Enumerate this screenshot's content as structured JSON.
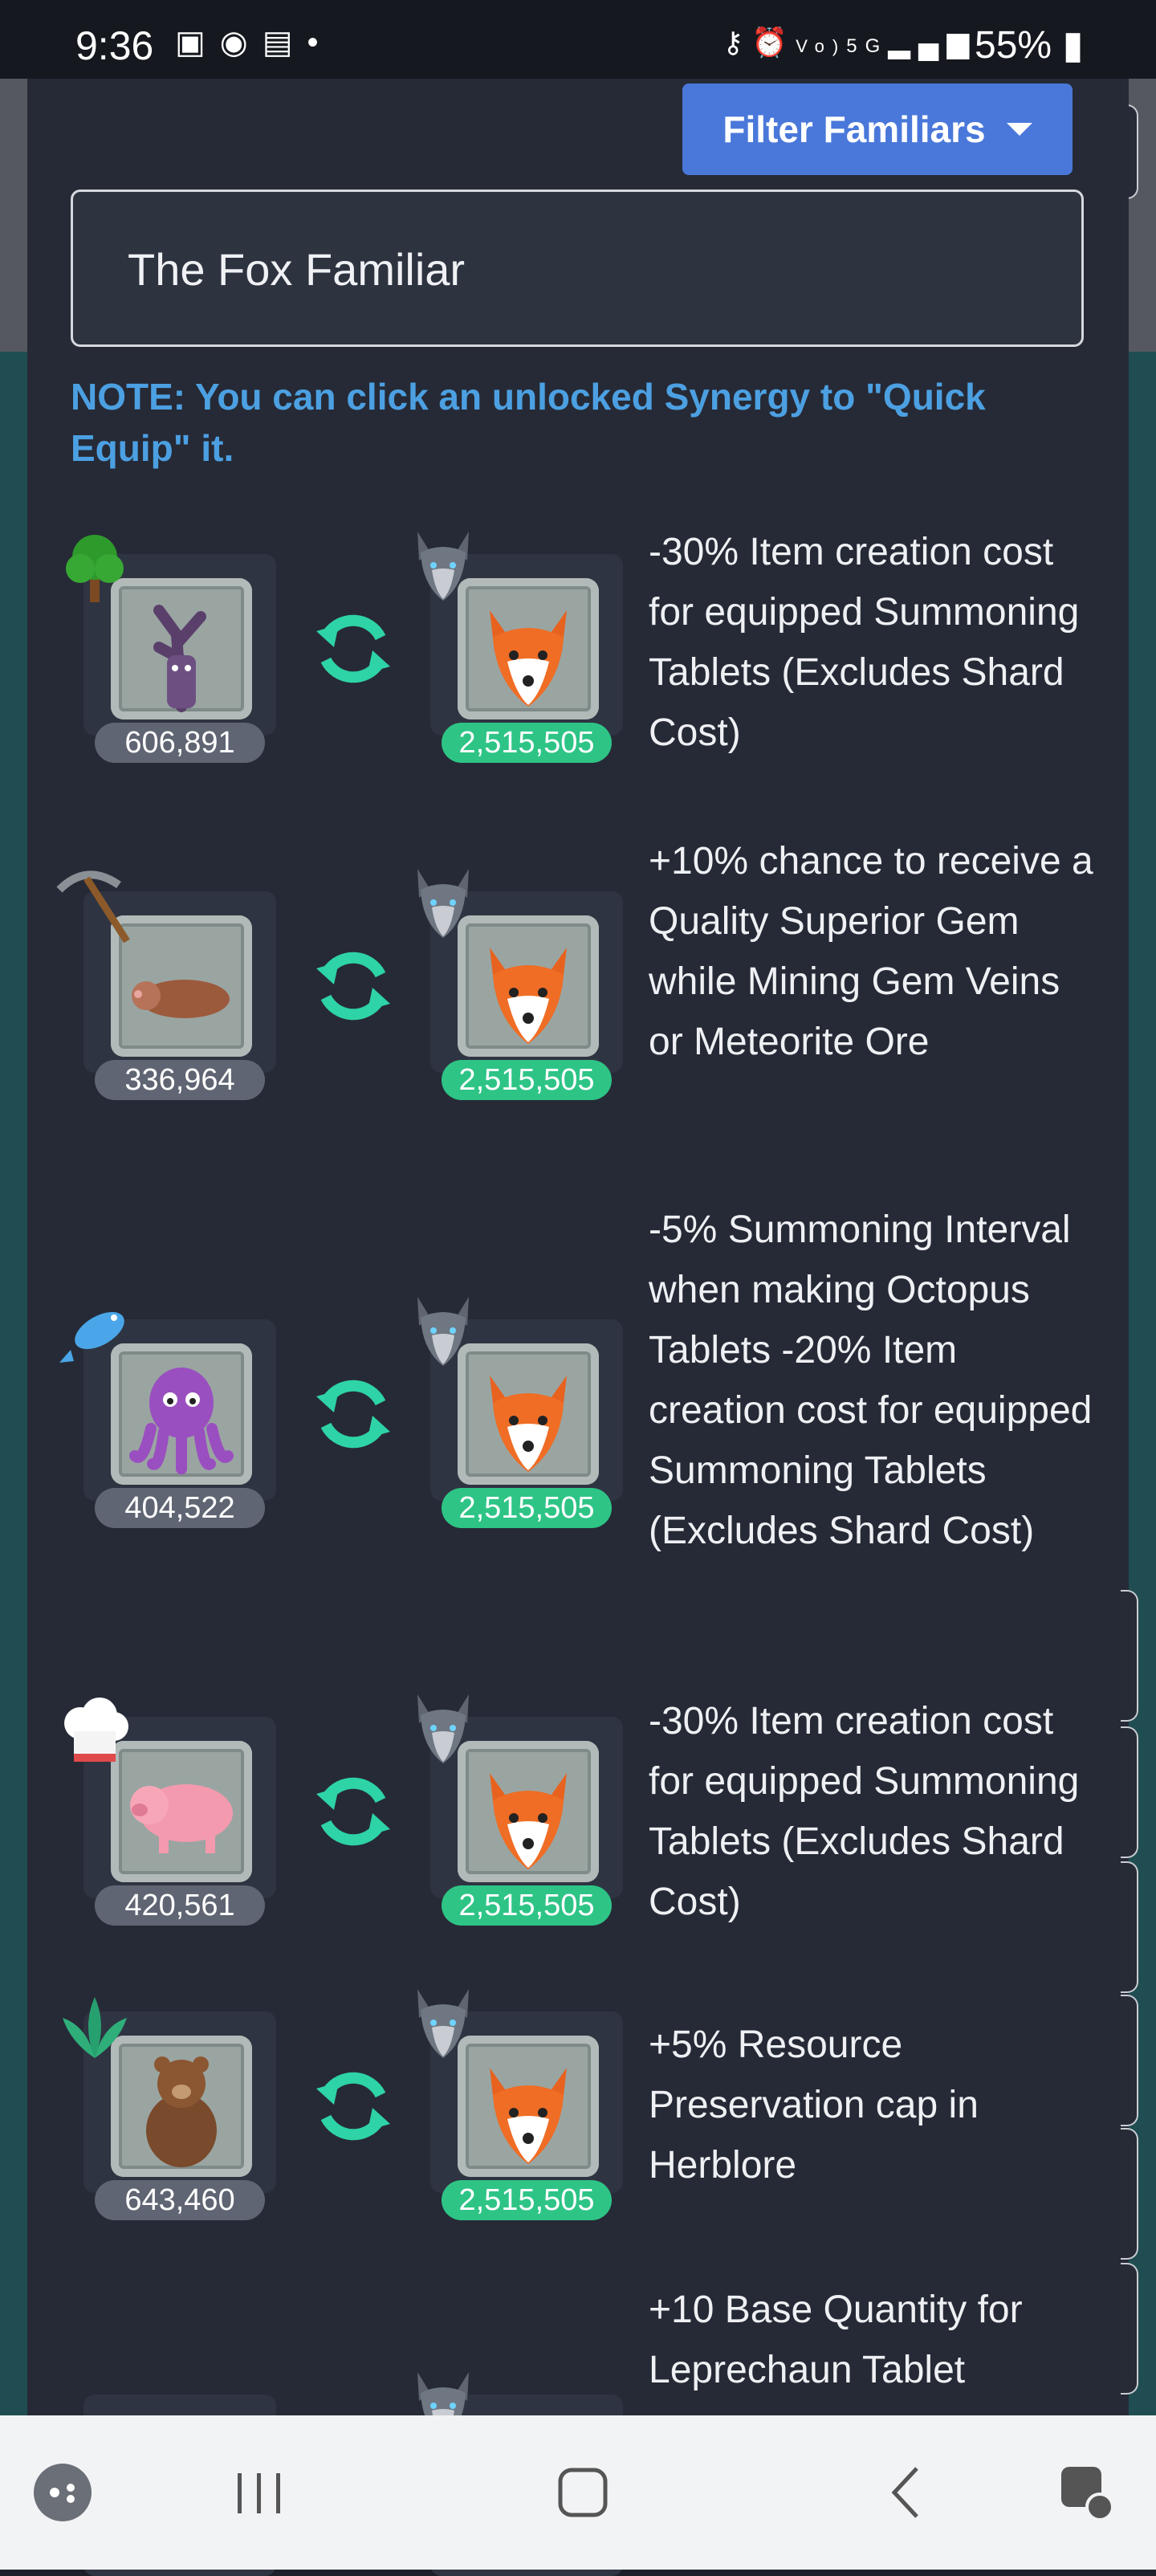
{
  "status_bar": {
    "time": "9:36",
    "left_icons": [
      "gallery-icon",
      "messenger-icon",
      "outlook-icon",
      "dot-icon"
    ],
    "right_icons": [
      "key-icon",
      "alarm-icon",
      "volte-icon",
      "5g-icon",
      "signal-icon"
    ],
    "battery": "55%"
  },
  "header": {
    "filter_button_label": "Filter Familiars"
  },
  "search": {
    "value": "The Fox Familiar",
    "placeholder": ""
  },
  "note": "NOTE: You can click an unlocked Synergy to \"Quick Equip\" it.",
  "colors": {
    "accent_blue": "#4a78da",
    "note_blue": "#4ca0e2",
    "unlocked_green": "#2ec486",
    "locked_grey": "#5f6572",
    "sync_teal": "#2ed3a6"
  },
  "synergies": [
    {
      "skill_icon": "woodcutting-tree-icon",
      "familiar_icon": "ent-familiar-icon",
      "familiar_count": "606,891",
      "fox_count": "2,515,505",
      "description": "-30% Item creation cost for equipped Summoning Tablets (Excludes Shard Cost)"
    },
    {
      "skill_icon": "mining-pickaxe-icon",
      "familiar_icon": "mole-familiar-icon",
      "familiar_count": "336,964",
      "fox_count": "2,515,505",
      "description": "+10% chance to receive a Quality Superior Gem while Mining Gem Veins or Meteorite Ore"
    },
    {
      "skill_icon": "fishing-fish-icon",
      "familiar_icon": "octopus-familiar-icon",
      "familiar_count": "404,522",
      "fox_count": "2,515,505",
      "description": "-5% Summoning Interval when making Octopus Tablets -20% Item creation cost for equipped Summoning Tablets (Excludes Shard Cost)"
    },
    {
      "skill_icon": "cooking-hat-icon",
      "familiar_icon": "pig-familiar-icon",
      "familiar_count": "420,561",
      "fox_count": "2,515,505",
      "description": "-30% Item creation cost for equipped Summoning Tablets (Excludes Shard Cost)"
    },
    {
      "skill_icon": "herblore-leaf-icon",
      "familiar_icon": "bear-familiar-icon",
      "familiar_count": "643,460",
      "fox_count": "2,515,505",
      "description": "+5% Resource Preservation cap in Herblore"
    },
    {
      "skill_icon": "unknown-skill-icon",
      "familiar_icon": "leprechaun-familiar-icon",
      "familiar_count": "",
      "fox_count": "",
      "description": "+10 Base Quantity for Leprechaun Tablet"
    }
  ],
  "nav_bar": {
    "items": [
      "game-launcher-icon",
      "recent-apps-icon",
      "home-icon",
      "back-icon",
      "assistant-touch-icon"
    ]
  }
}
